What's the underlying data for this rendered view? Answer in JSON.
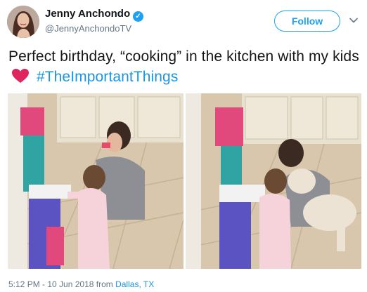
{
  "author": {
    "display_name": "Jenny Anchondo",
    "handle": "@JennyAnchondoTV",
    "verified_icon": "verified-badge-icon"
  },
  "actions": {
    "follow_label": "Follow",
    "more_icon": "chevron-down-icon"
  },
  "tweet": {
    "text_before": "Perfect birthday, “cooking” in the kitchen with my kids",
    "heart_icon": "red-heart-emoji",
    "hashtag": "#TheImportantThings"
  },
  "photos": [
    {
      "description_icon": "photo-kitchen-mom-toddler"
    },
    {
      "description_icon": "photo-kitchen-mom-toddler-dog"
    }
  ],
  "meta": {
    "time_date": "5:12 PM - 10 Jun 2018 from ",
    "location": "Dallas, TX"
  },
  "colors": {
    "accent": "#1da1f2",
    "link": "#1b95e0",
    "muted": "#657786",
    "heart": "#e0245e"
  }
}
